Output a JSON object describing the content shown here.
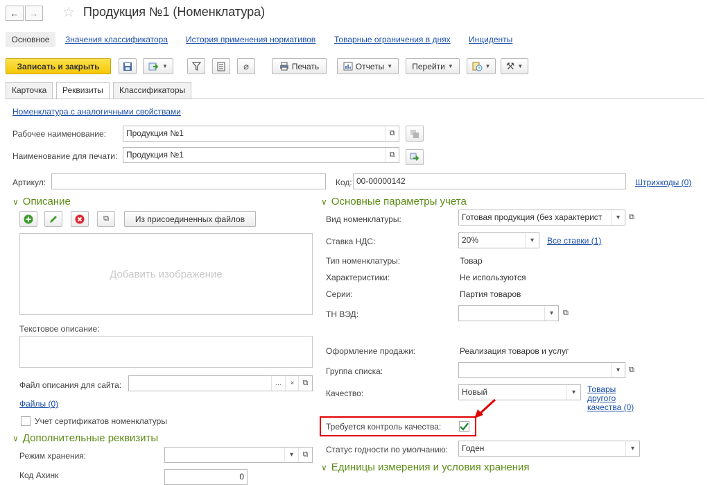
{
  "window": {
    "title": "Продукция №1 (Номенклатура)"
  },
  "top_tabs": [
    {
      "label": "Основное"
    },
    {
      "label": "Значения классификатора"
    },
    {
      "label": "История применения нормативов"
    },
    {
      "label": "Товарные ограничения в днях"
    },
    {
      "label": "Инциденты"
    }
  ],
  "toolbar": {
    "save_close": "Записать и закрыть",
    "print": "Печать",
    "reports": "Отчеты",
    "goto": "Перейти"
  },
  "form_tabs": [
    {
      "label": "Карточка"
    },
    {
      "label": "Реквизиты"
    },
    {
      "label": "Классификаторы"
    }
  ],
  "similar_link": "Номенклатура с аналогичными свойствами",
  "fields": {
    "work_name_label": "Рабочее наименование:",
    "work_name_value": "Продукция №1",
    "print_name_label": "Наименование для печати:",
    "print_name_value": "Продукция №1",
    "article_label": "Артикул:",
    "article_value": "",
    "code_label": "Код:",
    "code_value": "00-00000142",
    "barcodes_link": "Штрихкоды (0)"
  },
  "description": {
    "section_title": "Описание",
    "from_files_button": "Из присоединенных файлов",
    "add_image": "Добавить изображение",
    "text_desc_label": "Текстовое описание:",
    "site_file_label": "Файл описания для сайта:",
    "site_file_value": "",
    "files_link": "Файлы (0)",
    "certificates_label": "Учет сертификатов номенклатуры"
  },
  "additional": {
    "section_title": "Дополнительные реквизиты",
    "storage_mode_label": "Режим хранения:",
    "storage_mode_value": "",
    "next_label": "Код Ахинк",
    "next_value": "0"
  },
  "accounting": {
    "section_title": "Основные параметры учета",
    "kind_label": "Вид номенклатуры:",
    "kind_value": "Готовая продукция (без характерист",
    "vat_label": "Ставка НДС:",
    "vat_value": "20%",
    "all_rates_link": "Все ставки (1)",
    "type_label": "Тип номенклатуры:",
    "type_value": "Товар",
    "chars_label": "Характеристики:",
    "chars_value": "Не используются",
    "series_label": "Серии:",
    "series_value": "Партия товаров",
    "tnved_label": "ТН ВЭД:",
    "tnved_value": "",
    "sale_label": "Оформление продажи:",
    "sale_value": "Реализация товаров и услуг",
    "group_label": "Группа списка:",
    "group_value": "",
    "quality_label": "Качество:",
    "quality_value": "Новый",
    "other_quality_link_1": "Товары",
    "other_quality_link_2": "другого",
    "other_quality_link_3": "качества (0)",
    "quality_control_label": "Требуется контроль качества:",
    "quality_control_checked": true,
    "validity_label": "Статус годности по умолчанию:",
    "validity_value": "Годен"
  },
  "units": {
    "section_title": "Единицы измерения и условия хранения"
  },
  "colors": {
    "primary_button": "#f5c707",
    "section_title": "#5a8b14",
    "link": "#1a4ea8",
    "highlight": "#e00000"
  }
}
